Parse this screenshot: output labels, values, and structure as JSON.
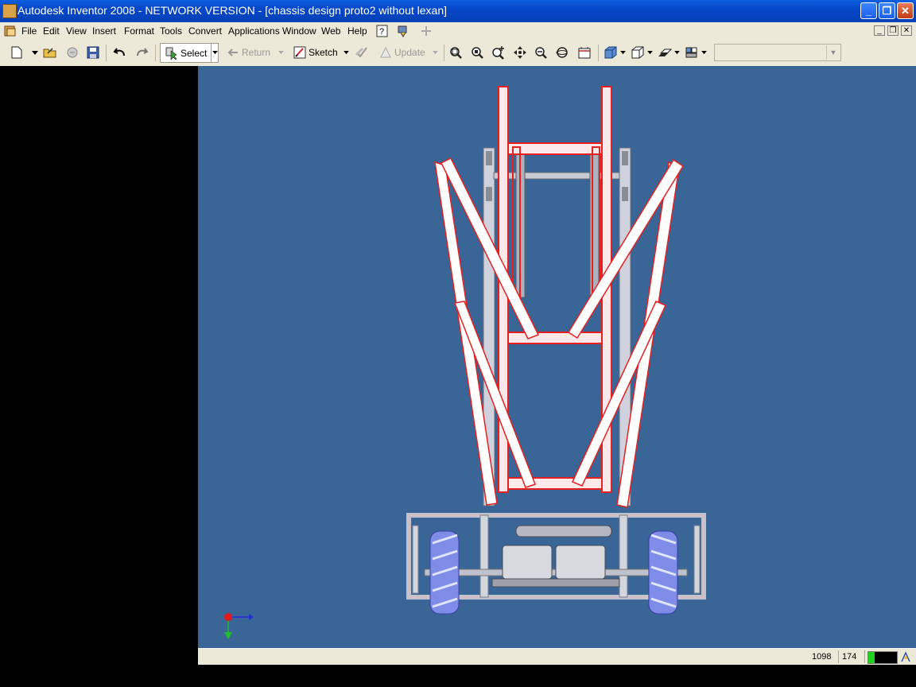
{
  "window": {
    "title": "Autodesk Inventor 2008 - NETWORK VERSION - [chassis design proto2 without lexan]"
  },
  "menu": {
    "items": [
      "File",
      "Edit",
      "View",
      "Insert",
      "Format",
      "Tools",
      "Convert",
      "Applications",
      "Window",
      "Web",
      "Help"
    ]
  },
  "toolbar": {
    "select_label": "Select",
    "return_label": "Return",
    "sketch_label": "Sketch",
    "update_label": "Update",
    "combo_value": ""
  },
  "statusbar": {
    "x_value": "1098",
    "y_value": "174"
  },
  "colors": {
    "viewport_bg": "#3a6597",
    "selected_frame": "#e52020",
    "titlebar": "#0a5fe0"
  }
}
